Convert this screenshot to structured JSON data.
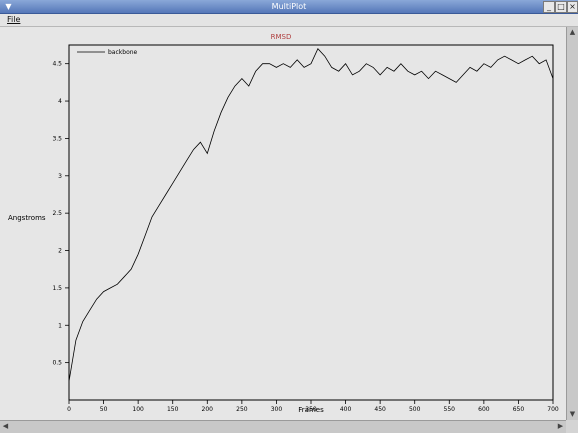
{
  "window": {
    "title": "MultiPlot"
  },
  "menu": {
    "file_label": "File"
  },
  "chart_data": {
    "type": "line",
    "title": "RMSD",
    "xlabel": "Frames",
    "ylabel": "Angstroms",
    "xlim": [
      0,
      700
    ],
    "ylim": [
      0,
      4.75
    ],
    "xticks": [
      0,
      50,
      100,
      150,
      200,
      250,
      300,
      350,
      400,
      450,
      500,
      550,
      600,
      650,
      700
    ],
    "yticks": [
      0.5,
      1,
      1.5,
      2,
      2.5,
      3,
      3.5,
      4,
      4.5
    ],
    "ytick_labels": [
      "0.5",
      "1",
      "1.5",
      "2",
      "2.5",
      "3",
      "3.5",
      "4",
      "4.5"
    ],
    "grid": false,
    "legend_position": "top-left",
    "colors": {
      "title": "#b04040",
      "line": "#000000"
    },
    "series": [
      {
        "name": "backbone",
        "x": [
          0,
          10,
          20,
          30,
          40,
          50,
          60,
          70,
          80,
          90,
          100,
          110,
          120,
          130,
          140,
          150,
          160,
          170,
          180,
          190,
          200,
          210,
          220,
          230,
          240,
          250,
          260,
          270,
          280,
          290,
          300,
          310,
          320,
          330,
          340,
          350,
          360,
          370,
          380,
          390,
          400,
          410,
          420,
          430,
          440,
          450,
          460,
          470,
          480,
          490,
          500,
          510,
          520,
          530,
          540,
          550,
          560,
          570,
          580,
          590,
          600,
          610,
          620,
          630,
          640,
          650,
          660,
          670,
          680,
          690,
          700
        ],
        "y": [
          0.25,
          0.8,
          1.05,
          1.2,
          1.35,
          1.45,
          1.5,
          1.55,
          1.65,
          1.75,
          1.95,
          2.2,
          2.45,
          2.6,
          2.75,
          2.9,
          3.05,
          3.2,
          3.35,
          3.45,
          3.3,
          3.6,
          3.85,
          4.05,
          4.2,
          4.3,
          4.2,
          4.4,
          4.5,
          4.5,
          4.45,
          4.5,
          4.45,
          4.55,
          4.45,
          4.5,
          4.7,
          4.6,
          4.45,
          4.4,
          4.5,
          4.35,
          4.4,
          4.5,
          4.45,
          4.35,
          4.45,
          4.4,
          4.5,
          4.4,
          4.35,
          4.4,
          4.3,
          4.4,
          4.35,
          4.3,
          4.25,
          4.35,
          4.45,
          4.4,
          4.5,
          4.45,
          4.55,
          4.6,
          4.55,
          4.5,
          4.55,
          4.6,
          4.5,
          4.55,
          4.3
        ]
      }
    ]
  }
}
